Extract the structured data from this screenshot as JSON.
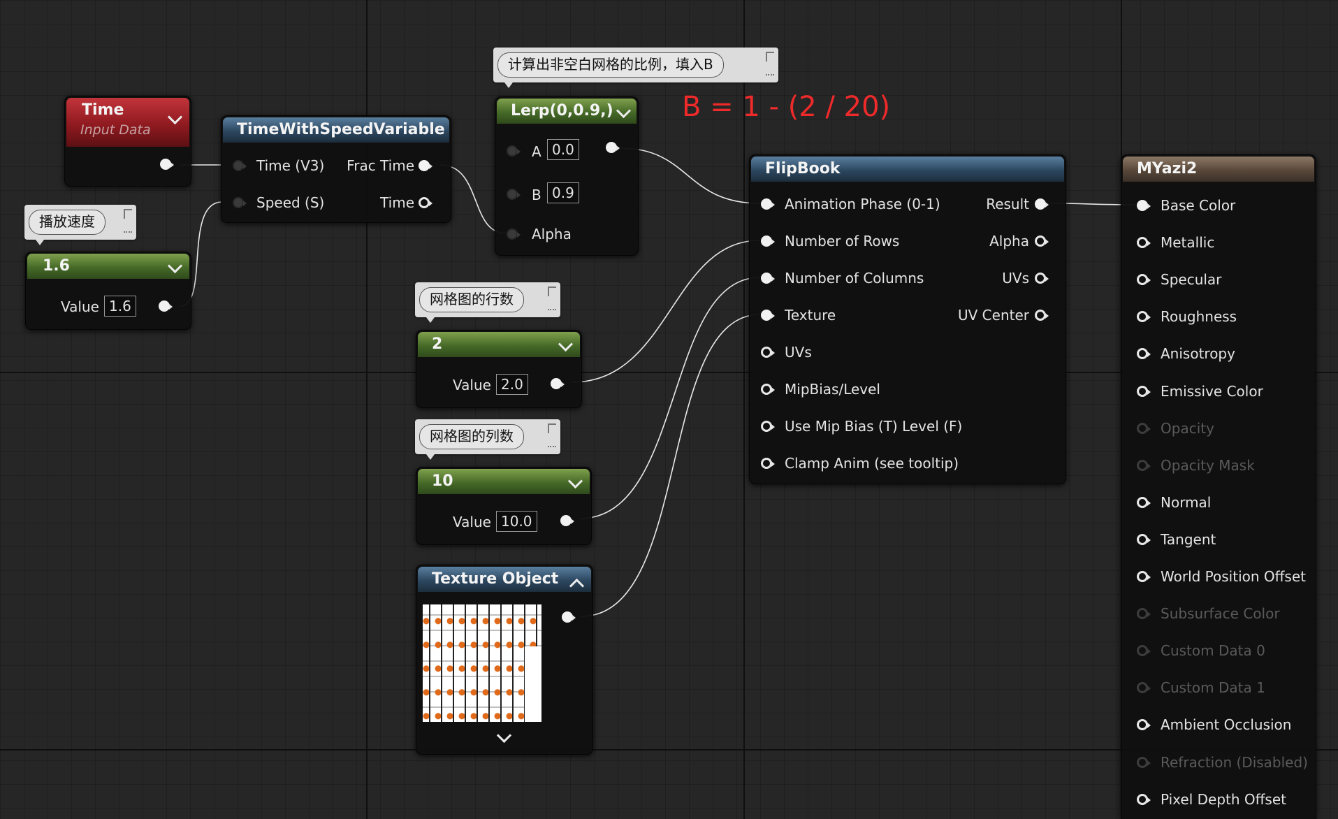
{
  "time_node": {
    "title": "Time",
    "subtitle": "Input Data"
  },
  "speed_comment": "播放速度",
  "speed_const": {
    "header": "1.6",
    "value_label": "Value",
    "value": "1.6"
  },
  "tws_node": {
    "title": "TimeWithSpeedVariable",
    "in_time": "Time (V3)",
    "in_speed": "Speed (S)",
    "out_frac": "Frac Time",
    "out_time": "Time"
  },
  "lerp_comment": "计算出非空白网格的比例，填入B",
  "lerp_node": {
    "title": "Lerp(0,0.9,)",
    "a_label": "A",
    "a_value": "0.0",
    "b_label": "B",
    "b_value": "0.9",
    "alpha_label": "Alpha"
  },
  "red_note": "B = 1 - (2 / 20)",
  "rows_comment": "网格图的行数",
  "rows_const": {
    "header": "2",
    "value_label": "Value",
    "value": "2.0"
  },
  "cols_comment": "网格图的列数",
  "cols_const": {
    "header": "10",
    "value_label": "Value",
    "value": "10.0"
  },
  "texture_node": {
    "title": "Texture Object"
  },
  "flipbook": {
    "title": "FlipBook",
    "inputs": [
      "Animation  Phase (0-1)",
      "Number of Rows",
      "Number of Columns",
      "Texture",
      "UVs",
      "MipBias/Level",
      "Use Mip Bias (T) Level (F)",
      "Clamp Anim (see tooltip)"
    ],
    "outputs": [
      "Result",
      "Alpha",
      "UVs",
      "UV Center"
    ]
  },
  "material": {
    "title": "MYazi2",
    "inputs": [
      {
        "label": "Base Color",
        "state": "filled"
      },
      {
        "label": "Metallic",
        "state": "hollow"
      },
      {
        "label": "Specular",
        "state": "hollow"
      },
      {
        "label": "Roughness",
        "state": "hollow"
      },
      {
        "label": "Anisotropy",
        "state": "hollow"
      },
      {
        "label": "Emissive Color",
        "state": "hollow"
      },
      {
        "label": "Opacity",
        "state": "dim"
      },
      {
        "label": "Opacity Mask",
        "state": "dim"
      },
      {
        "label": "Normal",
        "state": "hollow"
      },
      {
        "label": "Tangent",
        "state": "hollow"
      },
      {
        "label": "World Position Offset",
        "state": "hollow"
      },
      {
        "label": "Subsurface Color",
        "state": "dim"
      },
      {
        "label": "Custom Data 0",
        "state": "dim"
      },
      {
        "label": "Custom Data 1",
        "state": "dim"
      },
      {
        "label": "Ambient Occlusion",
        "state": "hollow"
      },
      {
        "label": "Refraction (Disabled)",
        "state": "dim"
      },
      {
        "label": "Pixel Depth Offset",
        "state": "hollow"
      }
    ]
  }
}
